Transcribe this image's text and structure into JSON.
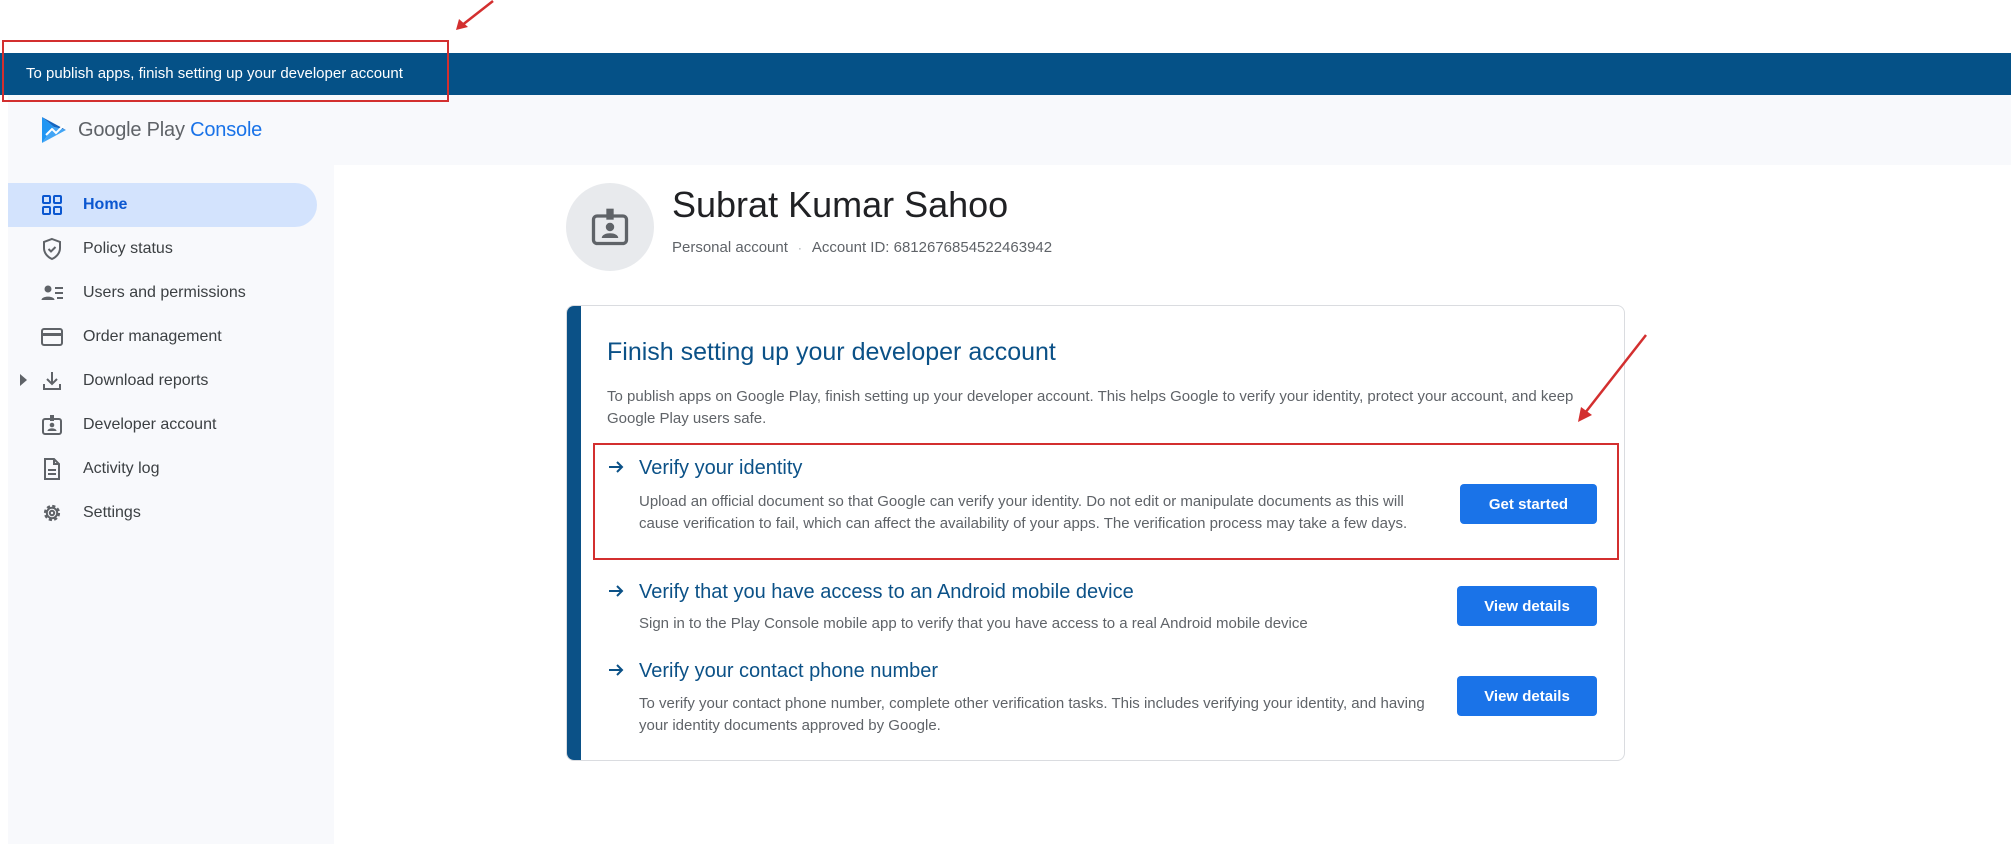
{
  "banner": {
    "text": "To publish apps, finish setting up your developer account"
  },
  "logo": {
    "google_play": "Google Play",
    "console": "Console"
  },
  "sidebar": {
    "items": [
      {
        "label": "Home",
        "icon": "dashboard-icon",
        "active": true
      },
      {
        "label": "Policy status",
        "icon": "shield-icon"
      },
      {
        "label": "Users and permissions",
        "icon": "users-icon"
      },
      {
        "label": "Order management",
        "icon": "credit-card-icon"
      },
      {
        "label": "Download reports",
        "icon": "download-icon",
        "expandable": true
      },
      {
        "label": "Developer account",
        "icon": "badge-icon"
      },
      {
        "label": "Activity log",
        "icon": "document-icon"
      },
      {
        "label": "Settings",
        "icon": "gear-icon"
      }
    ]
  },
  "profile": {
    "name": "Subrat Kumar Sahoo",
    "account_type": "Personal account",
    "separator": "·",
    "account_id": "Account ID: 6812676854522463942"
  },
  "setup_card": {
    "title": "Finish setting up your developer account",
    "description": "To publish apps on Google Play, finish setting up your developer account. This helps Google to verify your identity, protect your account, and keep Google Play users safe.",
    "tasks": [
      {
        "title": "Verify your identity",
        "description": "Upload an official document so that Google can verify your identity. Do not edit or manipulate documents as this will cause verification to fail, which can affect the availability of your apps. The verification process may take a few days.",
        "button": "Get started"
      },
      {
        "title": "Verify that you have access to an Android mobile device",
        "description": "Sign in to the Play Console mobile app to verify that you have access to a real Android mobile device",
        "button": "View details"
      },
      {
        "title": "Verify your contact phone number",
        "description": "To verify your contact phone number, complete other verification tasks. This includes verifying your identity, and having your identity documents approved by Google.",
        "button": "View details"
      }
    ]
  },
  "colors": {
    "banner_bg": "#055187",
    "accent": "#0b5187",
    "button": "#1a73e8",
    "active_nav_bg": "#d3e3fd",
    "annotation": "#d32f2f"
  }
}
